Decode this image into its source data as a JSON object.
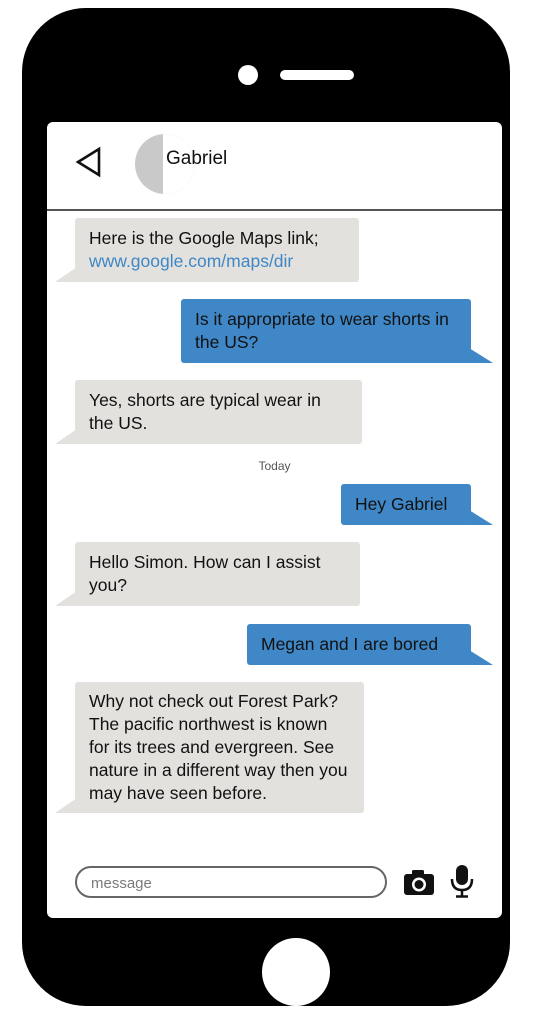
{
  "conversation": {
    "contact_name": "Gabriel",
    "messages": [
      {
        "direction": "incoming",
        "text": "Here is the Google Maps link;",
        "link": "www.google.com/maps/dir"
      },
      {
        "direction": "outgoing",
        "text": "Is it appropriate to wear shorts in the US?"
      },
      {
        "direction": "incoming",
        "text": "Yes, shorts are typical wear in the US."
      },
      {
        "direction": "outgoing",
        "text": "Hey Gabriel"
      },
      {
        "direction": "incoming",
        "text": "Hello Simon. How can I assist you?"
      },
      {
        "direction": "outgoing",
        "text": "Megan and I are bored"
      },
      {
        "direction": "incoming",
        "text": "Why not check out Forest Park? The pacific northwest is known for its trees and evergreen. See nature in a different way then you may have seen before."
      }
    ],
    "divider_label": "Today"
  },
  "composer": {
    "placeholder": "message"
  },
  "icons": {
    "back": "back-arrow-icon",
    "camera": "camera-icon",
    "mic": "microphone-icon",
    "avatar": "avatar"
  },
  "colors": {
    "incoming_bubble": "#e3e1dd",
    "outgoing_bubble": "#3f87c6",
    "link": "#3f87c6",
    "phone_frame": "#000000"
  }
}
